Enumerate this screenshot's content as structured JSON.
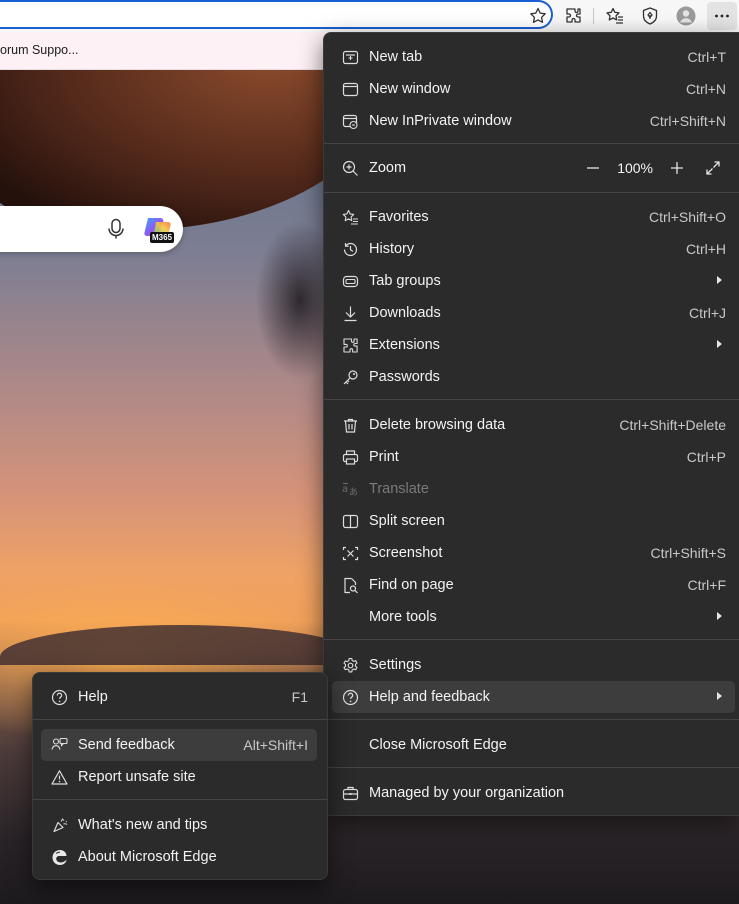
{
  "toolbar": {
    "icons": [
      "star-icon",
      "extensions-icon",
      "favorites-icon",
      "browser-essentials-icon",
      "profile-avatar",
      "more-icon"
    ]
  },
  "favorites_bar": {
    "items": [
      "orum Suppo..."
    ]
  },
  "search_box": {
    "icons": [
      "microphone-icon",
      "copilot-m365-icon"
    ],
    "badge": "M365"
  },
  "menu": {
    "items": [
      {
        "label": "New tab",
        "shortcut": "Ctrl+T",
        "icon": "new-tab-icon"
      },
      {
        "label": "New window",
        "shortcut": "Ctrl+N",
        "icon": "new-window-icon"
      },
      {
        "label": "New InPrivate window",
        "shortcut": "Ctrl+Shift+N",
        "icon": "inprivate-icon"
      },
      {
        "label": "Zoom",
        "icon": "zoom-icon"
      },
      {
        "label": "Favorites",
        "shortcut": "Ctrl+Shift+O",
        "icon": "favorites-icon"
      },
      {
        "label": "History",
        "shortcut": "Ctrl+H",
        "icon": "history-icon"
      },
      {
        "label": "Tab groups",
        "icon": "tab-groups-icon"
      },
      {
        "label": "Downloads",
        "shortcut": "Ctrl+J",
        "icon": "download-icon"
      },
      {
        "label": "Extensions",
        "icon": "extensions-icon"
      },
      {
        "label": "Passwords",
        "icon": "key-icon"
      },
      {
        "label": "Delete browsing data",
        "shortcut": "Ctrl+Shift+Delete",
        "icon": "trash-icon"
      },
      {
        "label": "Print",
        "shortcut": "Ctrl+P",
        "icon": "printer-icon"
      },
      {
        "label": "Translate",
        "icon": "translate-icon"
      },
      {
        "label": "Split screen",
        "icon": "split-screen-icon"
      },
      {
        "label": "Screenshot",
        "shortcut": "Ctrl+Shift+S",
        "icon": "screenshot-icon"
      },
      {
        "label": "Find on page",
        "shortcut": "Ctrl+F",
        "icon": "find-icon"
      },
      {
        "label": "More tools"
      },
      {
        "label": "Settings",
        "icon": "gear-icon"
      },
      {
        "label": "Help and feedback",
        "icon": "help-icon"
      },
      {
        "label": "Close Microsoft Edge"
      },
      {
        "label": "Managed by your organization",
        "icon": "briefcase-icon"
      }
    ],
    "zoom": {
      "value": "100%"
    }
  },
  "submenu": {
    "items": [
      {
        "label": "Help",
        "shortcut": "F1",
        "icon": "help-icon"
      },
      {
        "label": "Send feedback",
        "shortcut": "Alt+Shift+I",
        "icon": "feedback-icon"
      },
      {
        "label": "Report unsafe site",
        "icon": "warning-icon"
      },
      {
        "label": "What's new and tips",
        "icon": "sparkle-icon"
      },
      {
        "label": "About Microsoft Edge",
        "icon": "edge-logo-icon"
      }
    ]
  }
}
